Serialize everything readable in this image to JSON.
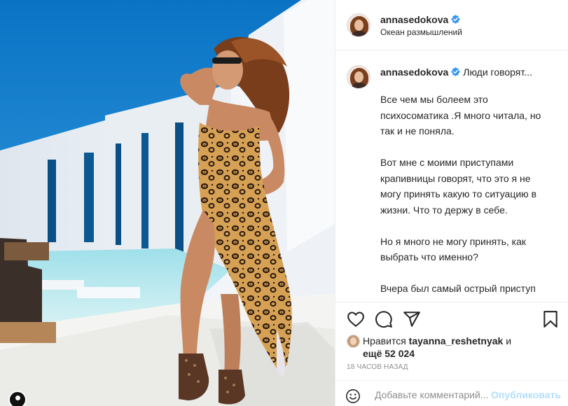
{
  "post": {
    "username": "annasedokova",
    "location": "Океан размышлений",
    "caption_first_line": "Люди говорят...",
    "caption_paragraphs": [
      "Все чем мы болеем это психосоматика .Я много читала, но так и не поняла.",
      "Вот мне с моими приступами крапивницы говорят, что это я не могу принять какую то ситуацию в жизни. Что то держу в себе.",
      "Но я много не могу принять, как выбрать что именно?",
      "Вчера был самый острый приступ крапивницы за все время. Мое лицо надулось, губы стали огромными, глаза заплыли, тело покрылось"
    ],
    "likes_prefix": "Нравится",
    "liked_by": "tayanna_reshetnyak",
    "likes_and": "и",
    "likes_more": "ещё 52 024",
    "time_ago": "18 ЧАСОВ НАЗАД"
  },
  "comment": {
    "placeholder": "Добавьте комментарий...",
    "post_label": "Опубликовать"
  },
  "icons": {
    "like": "heart-icon",
    "comment": "comment-bubble-icon",
    "share": "paper-plane-icon",
    "save": "bookmark-icon",
    "emoji": "smiley-icon",
    "verified": "verified-badge-icon"
  },
  "colors": {
    "verified": "#3897f0",
    "publish_disabled": "#b2dffc",
    "muted_text": "#8e8e8e"
  }
}
